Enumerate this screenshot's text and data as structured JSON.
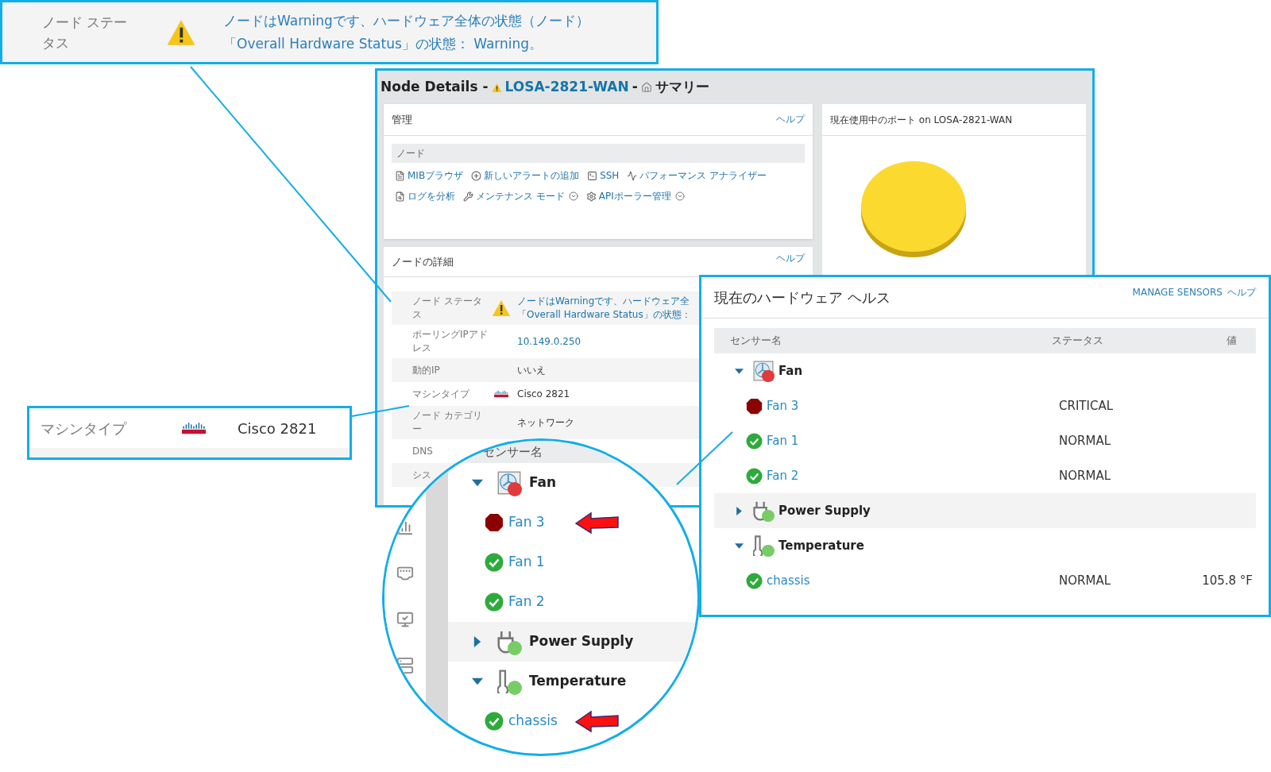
{
  "status_callout": {
    "label": "ノード ステータス",
    "message_lines": [
      "ノードはWarningです、ハードウェア全体の状態（ノード）",
      "「Overall Hardware Status」の状態： Warning。"
    ]
  },
  "node_details": {
    "title": "Node Details -",
    "node_name": "LOSA-2821-WAN",
    "separator": "-",
    "page": "サマリー",
    "management": {
      "title": "管理",
      "help": "ヘルプ",
      "section": "ノード",
      "action_rows": [
        [
          {
            "label": "MIBブラウザ",
            "kind": "mib",
            "dropdown": false
          },
          {
            "label": "新しいアラートの追加",
            "kind": "add",
            "dropdown": false
          },
          {
            "label": "SSH",
            "kind": "ssh",
            "dropdown": false
          },
          {
            "label": "パフォーマンス アナライザー",
            "kind": "perf",
            "dropdown": false
          }
        ],
        [
          {
            "label": "ログを分析",
            "kind": "log",
            "dropdown": false
          },
          {
            "label": "メンテナンス モード",
            "kind": "maintenance",
            "dropdown": true
          },
          {
            "label": "APIポーラー管理",
            "kind": "api",
            "dropdown": true
          }
        ]
      ]
    },
    "details": {
      "title": "ノードの詳細",
      "help": "ヘルプ",
      "rows": [
        {
          "label": "ノード ステータス",
          "kind": "status",
          "value_lines": [
            "ノードはWarningです、ハードウェア全",
            "「Overall Hardware Status」の状態："
          ]
        },
        {
          "label": "ポーリングIPアドレス",
          "kind": "link",
          "value_lines": [
            "10.149.0.250"
          ]
        },
        {
          "label": "動的IP",
          "kind": "plain",
          "value_lines": [
            "いいえ"
          ]
        },
        {
          "label": "マシンタイプ",
          "kind": "vendor",
          "value_lines": [
            "Cisco 2821"
          ]
        },
        {
          "label": "ノード カテゴリー",
          "kind": "plain",
          "value_lines": [
            "ネットワーク"
          ]
        },
        {
          "label": "DNS",
          "kind": "plain",
          "value_lines": []
        },
        {
          "label": "シス",
          "kind": "plain",
          "value_lines": []
        }
      ]
    },
    "ports": {
      "title": "現在使用中のポート on LOSA-2821-WAN"
    }
  },
  "machine_callout": {
    "label": "マシンタイプ",
    "value": "Cisco 2821"
  },
  "hardware_health": {
    "title": "現在のハードウェア ヘルス",
    "manage": "MANAGE SENSORS",
    "help": "ヘルプ",
    "columns": [
      "センサー名",
      "ステータス",
      "値"
    ],
    "groups": [
      {
        "name": "Fan",
        "kind": "fan",
        "expanded": true,
        "highlighted": false,
        "color": "#e03a3a",
        "children": [
          {
            "name": "Fan 3",
            "kind": "critical",
            "status": "CRITICAL"
          },
          {
            "name": "Fan 1",
            "kind": "normal",
            "status": "NORMAL"
          },
          {
            "name": "Fan 2",
            "kind": "normal",
            "status": "NORMAL"
          }
        ]
      },
      {
        "name": "Power Supply",
        "kind": "power",
        "expanded": false,
        "highlighted": true,
        "color": "#77cc66"
      },
      {
        "name": "Temperature",
        "kind": "temperature",
        "expanded": true,
        "highlighted": false,
        "color": "#77cc66",
        "children": [
          {
            "name": "chassis",
            "kind": "normal",
            "status": "NORMAL",
            "value": "105.8 °F"
          }
        ]
      }
    ]
  },
  "magnifier": {
    "column": "センサー名",
    "groups": [
      {
        "name": "Fan",
        "kind": "fan",
        "expanded": true,
        "highlighted": false,
        "color": "#e03a3a",
        "children": [
          {
            "name": "Fan 3",
            "kind": "critical",
            "arrow": true
          },
          {
            "name": "Fan 1",
            "kind": "normal",
            "arrow": false
          },
          {
            "name": "Fan 2",
            "kind": "normal",
            "arrow": false
          }
        ]
      },
      {
        "name": "Power Supply",
        "kind": "power",
        "expanded": false,
        "highlighted": true,
        "color": "#77cc66"
      },
      {
        "name": "Temperature",
        "kind": "temperature",
        "expanded": true,
        "highlighted": false,
        "color": "#77cc66",
        "children": [
          {
            "name": "chassis",
            "kind": "normal",
            "arrow": true
          }
        ]
      }
    ]
  }
}
